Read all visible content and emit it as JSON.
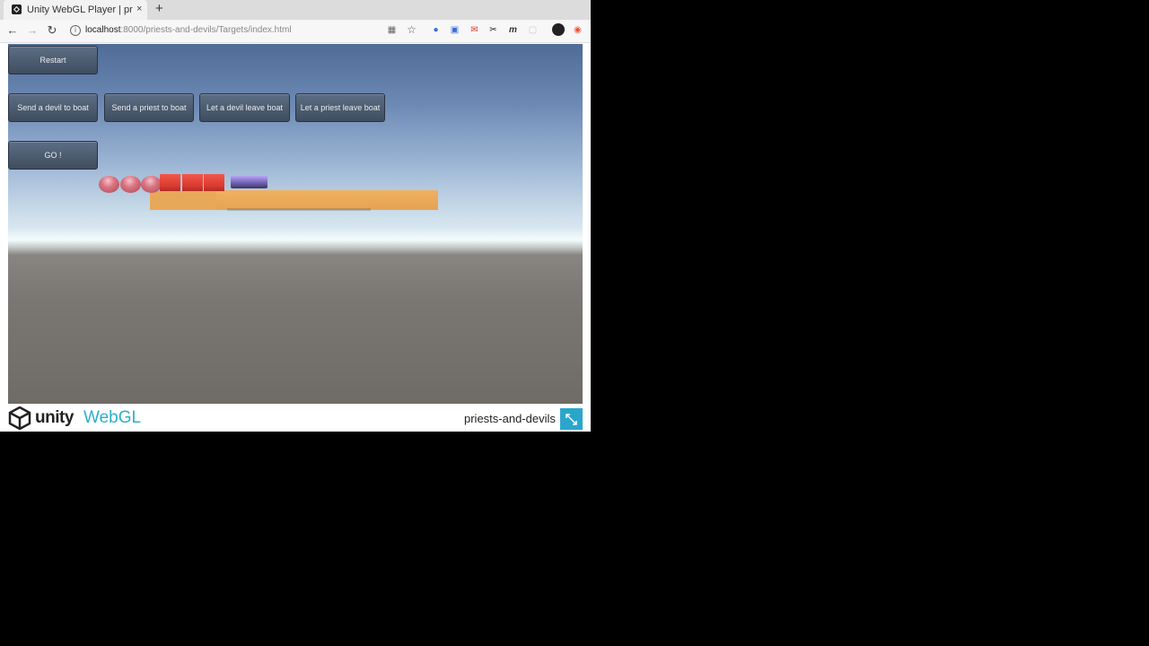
{
  "browser": {
    "tab": {
      "title": "Unity WebGL Player | priests-and-devils",
      "close": "×"
    },
    "new_tab": "+",
    "address": {
      "host": "localhost",
      "path": ":8000/priests-and-devils/Targets/index.html"
    }
  },
  "game": {
    "buttons": {
      "restart": "Restart",
      "send_devil": "Send a devil to boat",
      "send_priest": "Send a priest to boat",
      "devil_leave": "Let a devil leave boat",
      "priest_leave": "Let a priest leave boat",
      "go": "GO !"
    },
    "scene": {
      "priests_on_left_bank": 3,
      "devils_on_left_bank": 3,
      "colors": {
        "priest": "#d9727f",
        "devil": "#e04236",
        "boat": "#8a78d2",
        "bank": "#e8a859"
      }
    }
  },
  "footer": {
    "logo_unity": "unity",
    "logo_webgl": "WebGL",
    "title": "priests-and-devils"
  }
}
